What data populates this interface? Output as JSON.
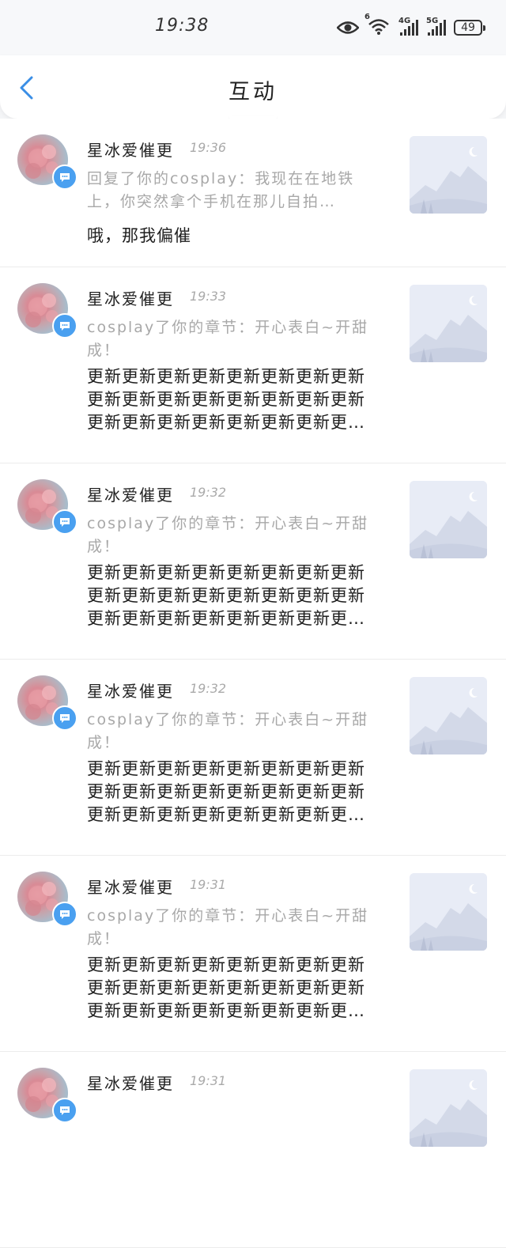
{
  "status_bar": {
    "time": "19:38",
    "wifi_label": "6",
    "sim1_label": "4G",
    "sim2_label": "5G",
    "battery": "49"
  },
  "header": {
    "title": "互动",
    "back_icon": "chevron-left-icon",
    "accent_color": "#3a8ee6"
  },
  "notifications": [
    {
      "user": "星冰爱催更",
      "time": "19:36",
      "summary": "回复了你的cosplay：我现在在地铁上，你突然拿个手机在那儿自拍…",
      "body": "哦，那我偏催"
    },
    {
      "user": "星冰爱催更",
      "time": "19:33",
      "summary": "cosplay了你的章节：开心表白~开甜成！",
      "body": "更新更新更新更新更新更新更新更新更新更新更新更新更新更新更新更新更新更新更新更新更新更新更新更新更新更新更新…"
    },
    {
      "user": "星冰爱催更",
      "time": "19:32",
      "summary": "cosplay了你的章节：开心表白~开甜成！",
      "body": "更新更新更新更新更新更新更新更新更新更新更新更新更新更新更新更新更新更新更新更新更新更新更新更新更新更新更新…"
    },
    {
      "user": "星冰爱催更",
      "time": "19:32",
      "summary": "cosplay了你的章节：开心表白~开甜成！",
      "body": "更新更新更新更新更新更新更新更新更新更新更新更新更新更新更新更新更新更新更新更新更新更新更新更新更新更新更新…"
    },
    {
      "user": "星冰爱催更",
      "time": "19:31",
      "summary": "cosplay了你的章节：开心表白~开甜成！",
      "body": "更新更新更新更新更新更新更新更新更新更新更新更新更新更新更新更新更新更新更新更新更新更新更新更新更新更新更新…"
    },
    {
      "user": "星冰爱催更",
      "time": "19:31",
      "summary": "",
      "body": ""
    }
  ]
}
